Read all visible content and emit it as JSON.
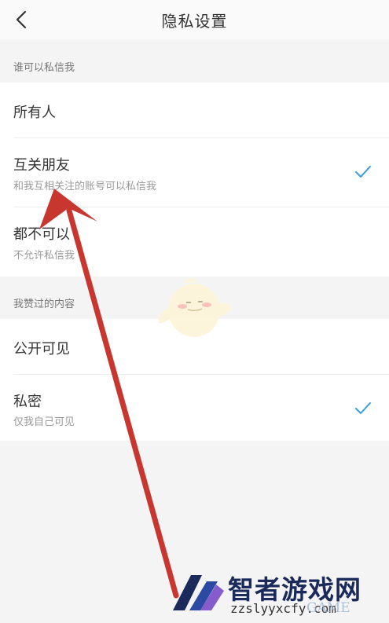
{
  "header": {
    "title": "隐私设置",
    "back_icon": "chevron-left-icon"
  },
  "sections": [
    {
      "header": "谁可以私信我",
      "items": [
        {
          "title": "所有人",
          "subtitle": "",
          "checked": false
        },
        {
          "title": "互关朋友",
          "subtitle": "和我互相关注的账号可以私信我",
          "checked": true
        },
        {
          "title": "都不可以",
          "subtitle": "不允许私信我",
          "checked": false
        }
      ]
    },
    {
      "header": "我赞过的内容",
      "items": [
        {
          "title": "公开可见",
          "subtitle": "",
          "checked": false
        },
        {
          "title": "私密",
          "subtitle": "仅我自己可见",
          "checked": true
        }
      ]
    }
  ],
  "watermark": {
    "name": "智者游戏网",
    "url": "zzslyyxcfy.com",
    "brand": "GAME"
  },
  "colors": {
    "check": "#3a9be0",
    "annotation_arrow": "#c8372f",
    "background": "#f4f4f5"
  }
}
